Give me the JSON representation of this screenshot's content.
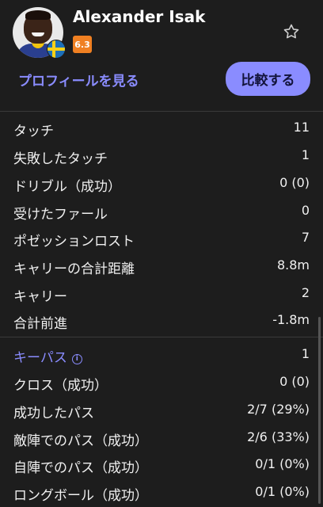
{
  "player": {
    "name": "Alexander Isak",
    "rating": "6.3",
    "flag_icon": "sweden-flag-icon"
  },
  "actions": {
    "profile_link": "プロフィールを見る",
    "compare_button": "比較する"
  },
  "colors": {
    "accent": "#8a8cff",
    "rating_badge": "#f08022",
    "background": "#1d1d1d"
  },
  "stats": [
    {
      "label": "タッチ",
      "value": "11"
    },
    {
      "label": "失敗したタッチ",
      "value": "1"
    },
    {
      "label": "ドリブル（成功）",
      "value": "0 (0)"
    },
    {
      "label": "受けたファール",
      "value": "0"
    },
    {
      "label": "ポゼッションロスト",
      "value": "7"
    },
    {
      "label": "キャリーの合計距離",
      "value": "8.8m"
    },
    {
      "label": "キャリー",
      "value": "2"
    },
    {
      "label": "合計前進",
      "value": "-1.8m"
    }
  ],
  "passing": [
    {
      "label": "キーパス",
      "value": "1"
    },
    {
      "label": "クロス（成功）",
      "value": "0 (0)"
    },
    {
      "label": "成功したパス",
      "value": "2/7 (29%)"
    },
    {
      "label": "敵陣でのパス（成功）",
      "value": "2/6 (33%)"
    },
    {
      "label": "自陣でのパス（成功）",
      "value": "0/1 (0%)"
    },
    {
      "label": "ロングボール（成功）",
      "value": "0/1 (0%)"
    }
  ]
}
